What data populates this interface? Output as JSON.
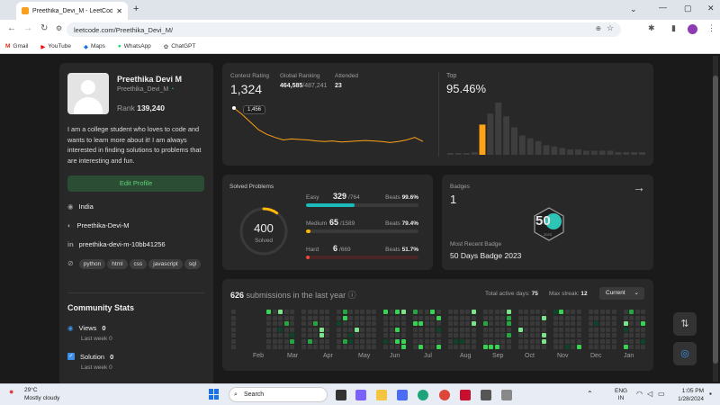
{
  "browser": {
    "tab_title": "Preethika_Devi_M - LeetCode P",
    "url": "leetcode.com/Preethika_Devi_M/",
    "bookmarks": [
      "Gmail",
      "YouTube",
      "Maps",
      "WhatsApp",
      "ChatGPT"
    ]
  },
  "profile": {
    "name": "Preethika Devi M",
    "username": "Preethika_Devi_M",
    "rank_label": "Rank",
    "rank": "139,240",
    "bio": "I am a college student who loves to code and wants to learn more about it! I am always interested in finding solutions to problems that are interesting and fun.",
    "edit_label": "Edit Profile",
    "location": "India",
    "github": "Preethika-Devi-M",
    "linkedin": "preethika-devi-m-10bb41256",
    "skills": [
      "python",
      "html",
      "css",
      "javascript",
      "sql"
    ]
  },
  "community": {
    "title": "Community Stats",
    "views_label": "Views",
    "views": "0",
    "views_sub": "Last week",
    "views_sub_val": "0",
    "solution_label": "Solution",
    "solution": "0",
    "solution_sub": "Last week",
    "solution_sub_val": "0"
  },
  "contest": {
    "rating_label": "Contest Rating",
    "rating": "1,324",
    "global_label": "Global Ranking",
    "global_rank": "464,585",
    "global_total": "/487,241",
    "attended_label": "Attended",
    "attended": "23",
    "tooltip": "1,456",
    "top_label": "Top",
    "top_value": "95.46%",
    "rating_line": [
      1456,
      1430,
      1400,
      1370,
      1352,
      1340,
      1330,
      1334,
      1332,
      1330,
      1326,
      1324,
      1326,
      1322,
      1324,
      1326,
      1328,
      1326,
      1324,
      1320,
      1324,
      1330,
      1340,
      1324
    ],
    "histogram": [
      1,
      1,
      1,
      2,
      22,
      30,
      38,
      28,
      20,
      14,
      12,
      10,
      7,
      6,
      5,
      4,
      4,
      3,
      3,
      3,
      3,
      2,
      2,
      2,
      2
    ],
    "highlight_bin": 4
  },
  "solved": {
    "title": "Solved Problems",
    "total": "400",
    "total_label": "Solved",
    "easy": {
      "label": "Easy",
      "count": "329",
      "total": "/764",
      "beats_label": "Beats",
      "beats": "99.6%",
      "fraction": 0.43,
      "color": "#1cbaba"
    },
    "medium": {
      "label": "Medium",
      "count": "65",
      "total": "/1589",
      "beats_label": "Beats",
      "beats": "79.4%",
      "fraction": 0.04,
      "color": "#ffb700"
    },
    "hard": {
      "label": "Hard",
      "count": "6",
      "total": "/669",
      "beats_label": "Beats",
      "beats": "51.7%",
      "fraction": 0.01,
      "color": "#ef4743"
    }
  },
  "badges": {
    "title": "Badges",
    "count": "1",
    "recent_label": "Most Recent Badge",
    "recent": "50 Days Badge 2023",
    "badge_text": "50",
    "badge_sub": "2023"
  },
  "calendar": {
    "count": "626",
    "label": "submissions in the last year",
    "active_label": "Total active days:",
    "active": "75",
    "streak_label": "Max streak:",
    "streak": "12",
    "dropdown": "Current",
    "months": [
      "Feb",
      "Mar",
      "Apr",
      "May",
      "Jun",
      "Jul",
      "Aug",
      "Sep",
      "Oct",
      "Nov",
      "Dec",
      "Jan"
    ]
  },
  "taskbar": {
    "temp": "29°C",
    "weather": "Mostly cloudy",
    "search": "Search",
    "lang1": "ENG",
    "lang2": "IN",
    "time": "1:05 PM",
    "date": "1/28/2024"
  }
}
